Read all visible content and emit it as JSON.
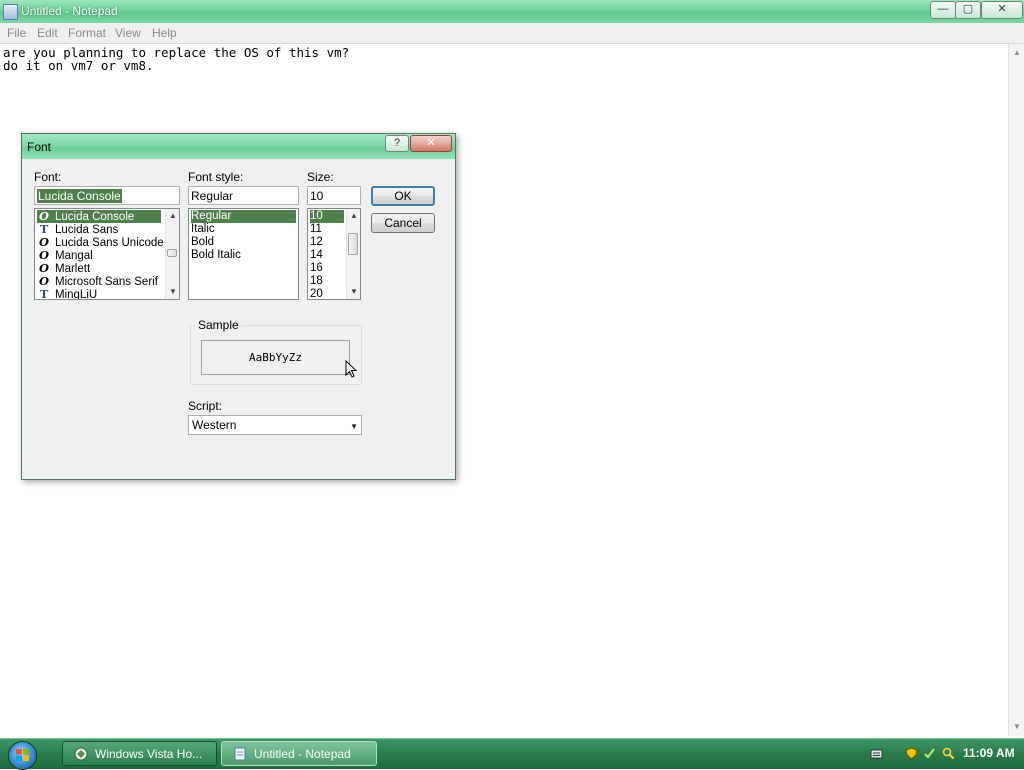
{
  "window": {
    "title": "Untitled - Notepad",
    "controls": {
      "minimize": "—",
      "maximize": "▢",
      "close": "✕"
    }
  },
  "menubar": [
    "File",
    "Edit",
    "Format",
    "View",
    "Help"
  ],
  "editor": {
    "lines": [
      "are you planning to replace the OS of this vm?",
      "do it on vm7 or vm8."
    ]
  },
  "dialog": {
    "title": "Font",
    "help_button": "?",
    "close_button": "✕",
    "font": {
      "label": "Font:",
      "value": "Lucida Console",
      "items": [
        {
          "name": "Lucida Console",
          "icon": "O",
          "selected": true
        },
        {
          "name": "Lucida Sans",
          "icon": "T",
          "selected": false
        },
        {
          "name": "Lucida Sans Unicode",
          "icon": "O",
          "selected": false
        },
        {
          "name": "Mangal",
          "icon": "O",
          "selected": false
        },
        {
          "name": "Marlett",
          "icon": "O",
          "selected": false
        },
        {
          "name": "Microsoft Sans Serif",
          "icon": "O",
          "selected": false
        },
        {
          "name": "MingLiU",
          "icon": "T",
          "selected": false
        }
      ]
    },
    "style": {
      "label": "Font style:",
      "value": "Regular",
      "items": [
        "Regular",
        "Italic",
        "Bold",
        "Bold Italic"
      ],
      "selected_index": 0
    },
    "size": {
      "label": "Size:",
      "value": "10",
      "items": [
        "10",
        "11",
        "12",
        "14",
        "16",
        "18",
        "20"
      ],
      "selected_index": 0
    },
    "ok_label": "OK",
    "cancel_label": "Cancel",
    "sample": {
      "label": "Sample",
      "text": "AaBbYyZz"
    },
    "script": {
      "label": "Script:",
      "value": "Western"
    }
  },
  "taskbar": {
    "buttons": [
      {
        "label": "Windows Vista Ho...",
        "active": false
      },
      {
        "label": "Untitled - Notepad",
        "active": true
      }
    ],
    "clock": "11:09 AM"
  },
  "colors": {
    "titlebar": "#6fd39b",
    "selection": "#4f7f4a",
    "taskbar": "#2c7d4b"
  }
}
